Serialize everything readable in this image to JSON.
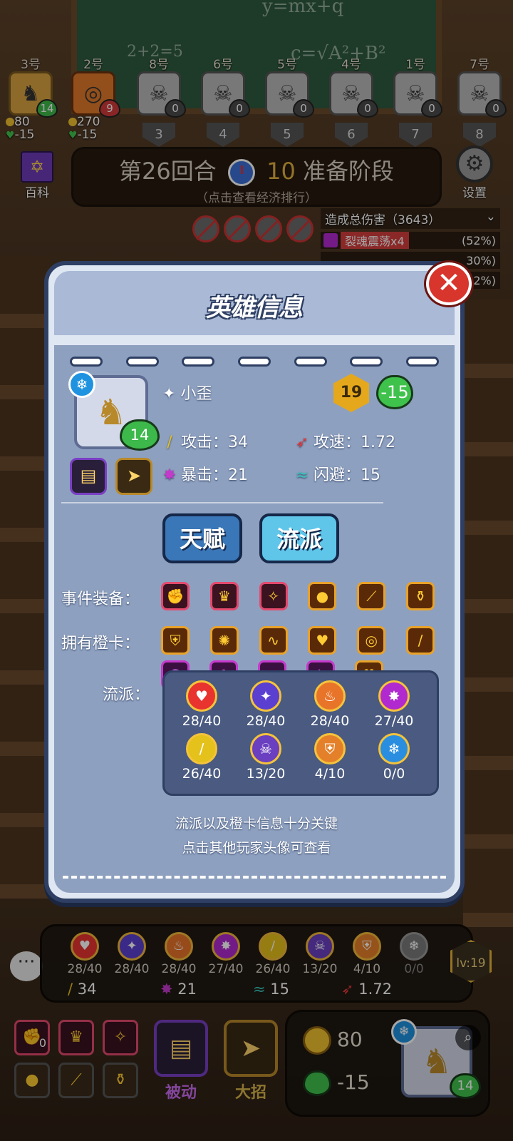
{
  "players": [
    {
      "num": "3号",
      "hp": "14",
      "hp_color": "#3fb94a",
      "coins": "80",
      "life": "-15",
      "is_me": true
    },
    {
      "num": "2号",
      "hp": "9",
      "hp_color": "#d23a3a",
      "coins": "270",
      "life": "-15",
      "is_me": false
    },
    {
      "num": "8号",
      "hp": "0",
      "rank": "3"
    },
    {
      "num": "6号",
      "hp": "0",
      "rank": "4"
    },
    {
      "num": "5号",
      "hp": "0",
      "rank": "5"
    },
    {
      "num": "4号",
      "hp": "0",
      "rank": "6"
    },
    {
      "num": "1号",
      "hp": "0",
      "rank": "7"
    },
    {
      "num": "7号",
      "hp": "0",
      "rank": "8"
    }
  ],
  "wiki_label": "百科",
  "settings_label": "设置",
  "round": {
    "title": "第26回合",
    "timer": "10",
    "phase": "准备阶段",
    "hint": "（点击查看经济排行）"
  },
  "damage": {
    "header": "造成总伤害（3643）",
    "rows": [
      {
        "name": "裂魂震荡x4",
        "pct": "(52%)"
      },
      {
        "name": "",
        "pct": "30%)"
      },
      {
        "name": "",
        "pct": "2%)"
      }
    ]
  },
  "modal": {
    "title": "英雄信息",
    "hero_name": "小歪",
    "level": "19",
    "life": "-15",
    "hero_hp": "14",
    "stats": {
      "attack": "攻击：34",
      "attack_speed": "攻速：1.72",
      "crit": "暴击：21",
      "dodge": "闪避：15"
    },
    "tab_talent": "天赋",
    "tab_school": "流派",
    "equip_label": "事件装备：",
    "orange_label": "拥有橙卡：",
    "school_label": "流派：",
    "schools": [
      {
        "value": "28/40",
        "color": "#e8332f",
        "icon": "heart-icon"
      },
      {
        "value": "28/40",
        "color": "#5a3fd0",
        "icon": "spirit-icon"
      },
      {
        "value": "28/40",
        "color": "#e8742a",
        "icon": "flame-icon"
      },
      {
        "value": "27/40",
        "color": "#b02ad0",
        "icon": "burst-icon"
      },
      {
        "value": "26/40",
        "color": "#e5c11c",
        "icon": "sword-icon"
      },
      {
        "value": "13/20",
        "color": "#6a3fc0",
        "icon": "skull-icon"
      },
      {
        "value": "4/10",
        "color": "#e5802a",
        "icon": "shield-icon"
      },
      {
        "value": "0/0",
        "color": "#2a8ee0",
        "icon": "snowflake-icon"
      }
    ],
    "tip_line1": "流派以及橙卡信息十分关键",
    "tip_line2": "点击其他玩家头像可查看"
  },
  "hud": {
    "schools": [
      "28/40",
      "28/40",
      "28/40",
      "27/40",
      "26/40",
      "13/20",
      "4/10",
      "0/0"
    ],
    "attack": "34",
    "crit": "21",
    "dodge": "15",
    "attack_speed": "1.72",
    "level": "lv:19"
  },
  "bottom": {
    "passive_label": "被动",
    "ult_label": "大招",
    "coins": "80",
    "life": "-15",
    "hp": "14",
    "equip_count": "0"
  },
  "chalkboard": {
    "formula1": "y=mx+q",
    "formula2": "c=√A²+B²",
    "formula3": "2+2=5"
  }
}
